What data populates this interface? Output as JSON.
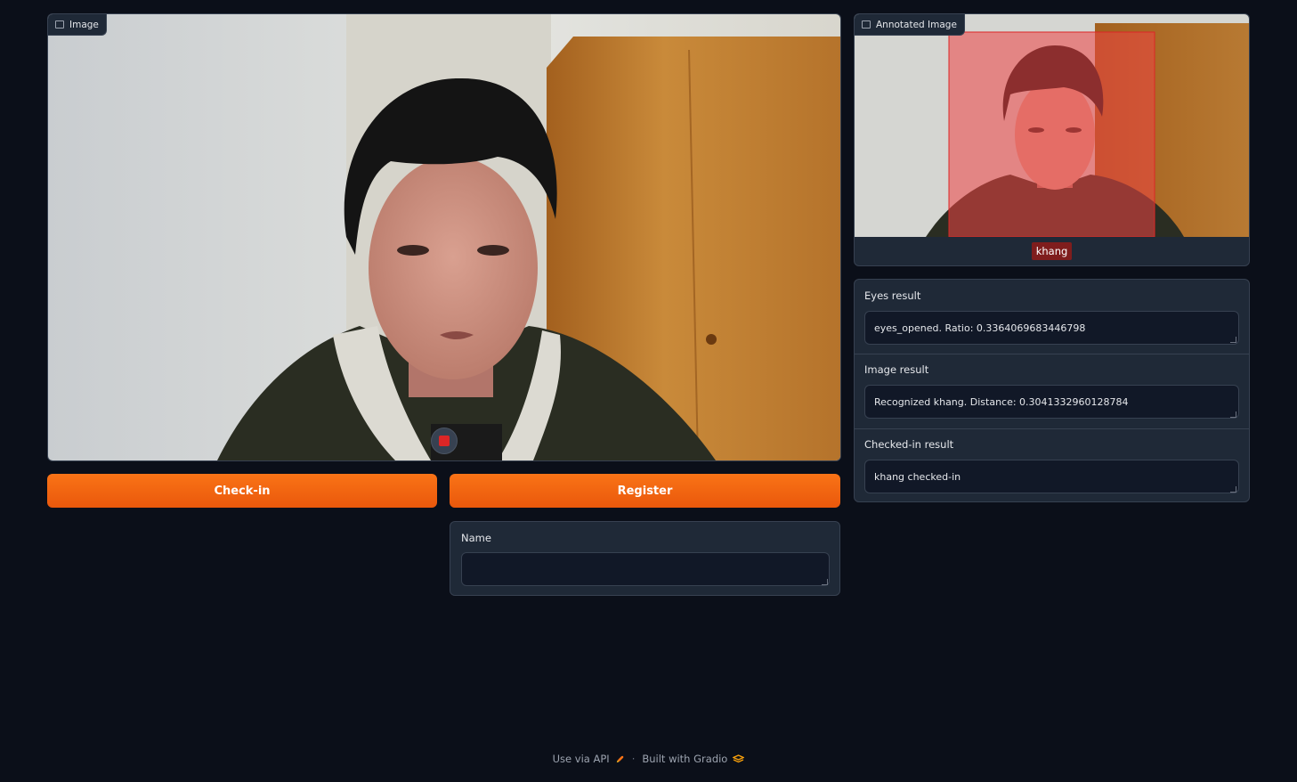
{
  "image_panel": {
    "label": "Image",
    "icon": "image-icon",
    "stop_icon": "stop-icon"
  },
  "buttons": {
    "checkin_label": "Check-in",
    "register_label": "Register",
    "accent_color": "#f97316"
  },
  "name_field": {
    "label": "Name",
    "value": ""
  },
  "annotated_panel": {
    "label": "Annotated Image",
    "icon": "image-icon",
    "annotation_label": "khang",
    "annotation_color": "#ef4444"
  },
  "results": {
    "eyes": {
      "label": "Eyes result",
      "value": "eyes_opened. Ratio: 0.3364069683446798"
    },
    "image": {
      "label": "Image result",
      "value": "Recognized khang. Distance: 0.3041332960128784"
    },
    "checked_in": {
      "label": "Checked-in result",
      "value": "khang checked-in"
    }
  },
  "footer": {
    "api_link": "Use via API",
    "api_icon": "rocket-icon",
    "separator": "·",
    "built_with": "Built with Gradio",
    "gradio_icon": "gradio-logo-icon"
  }
}
